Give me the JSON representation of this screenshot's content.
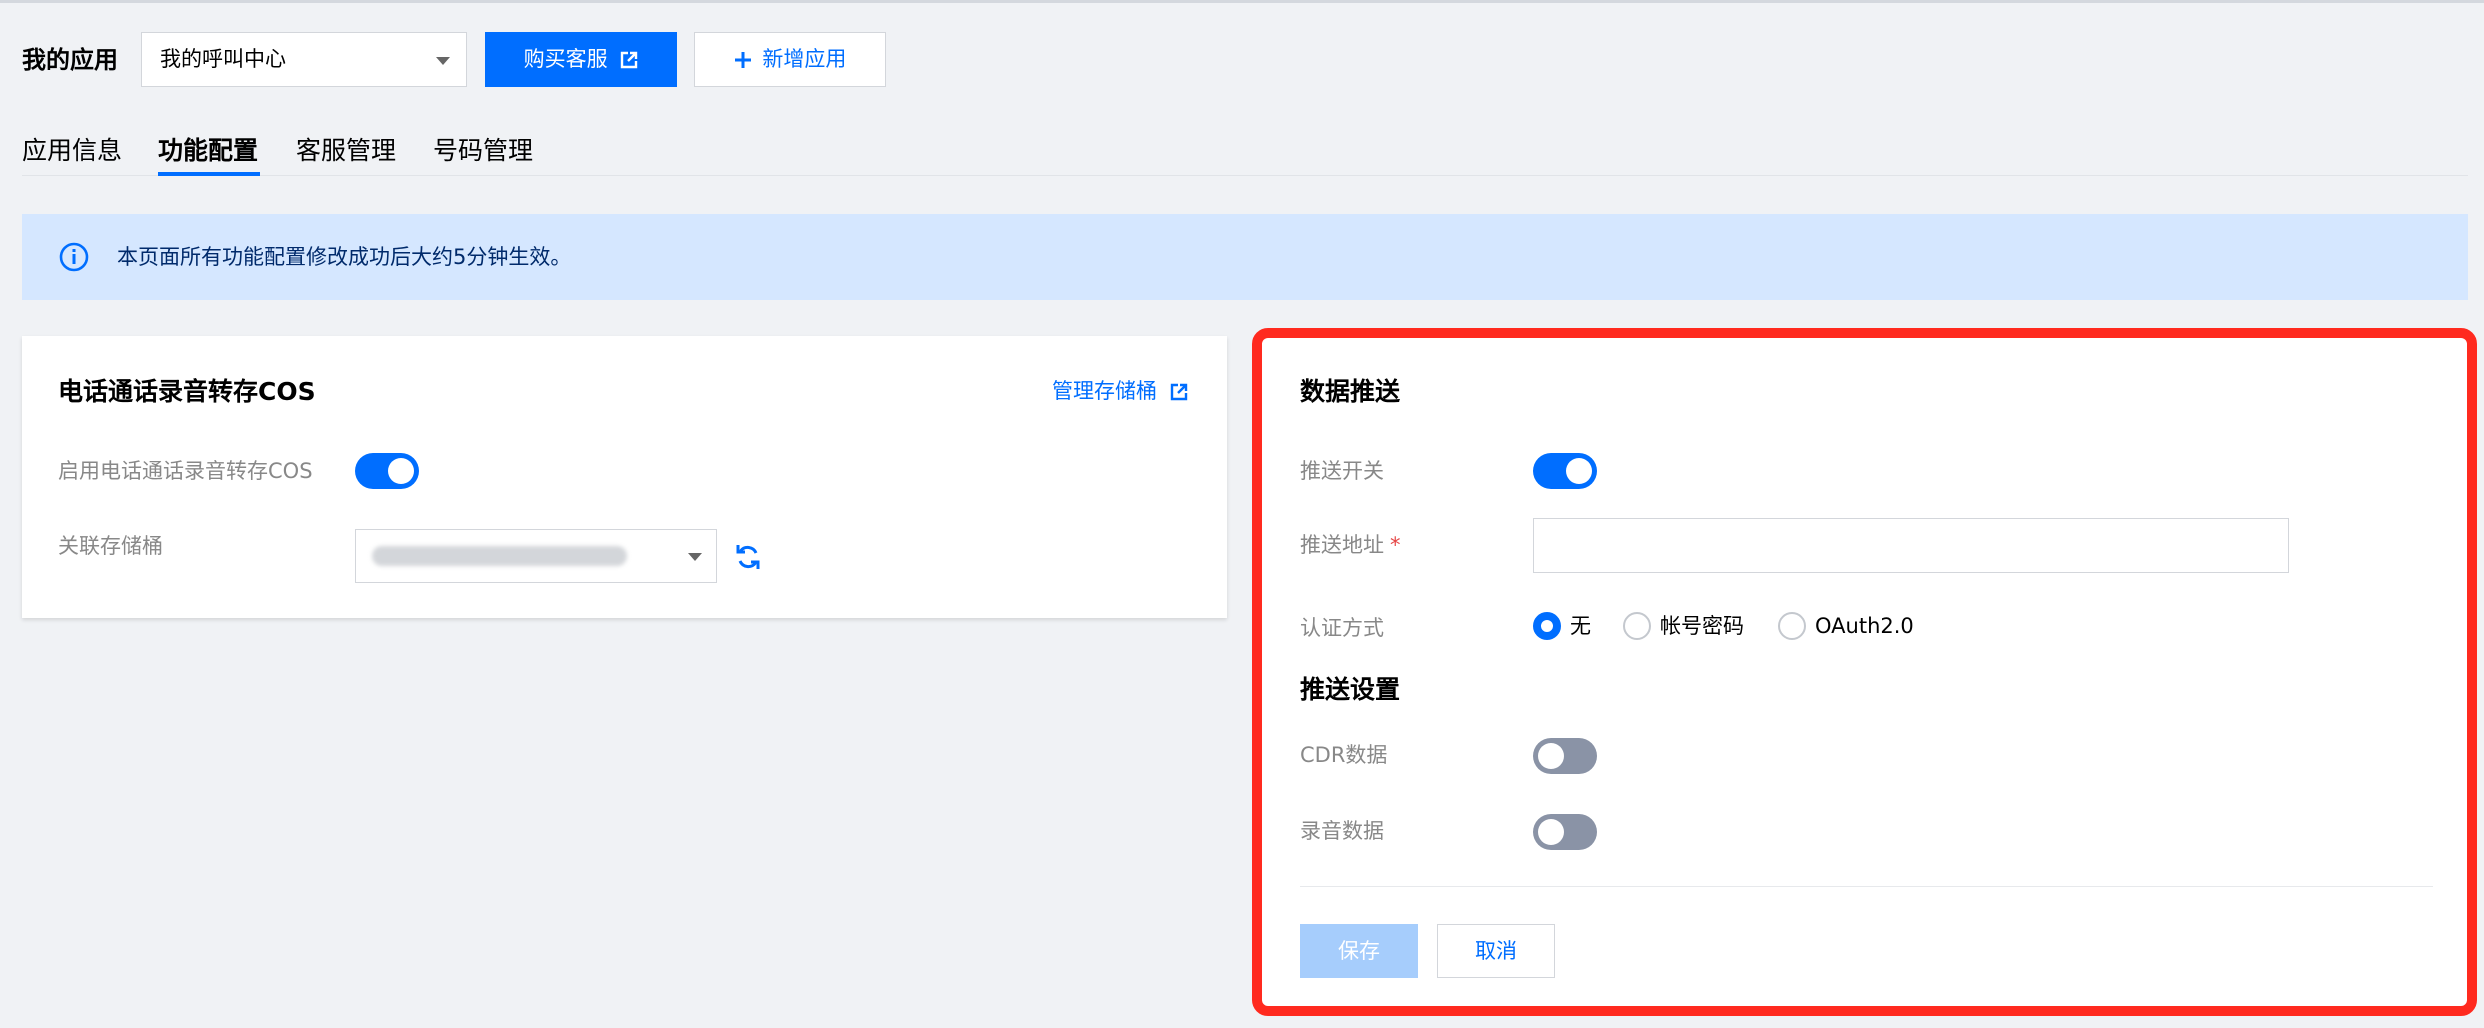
{
  "header": {
    "my_app_label": "我的应用",
    "app_select_value": "我的呼叫中心",
    "buy_button": "购买客服",
    "add_button": "新增应用"
  },
  "tabs": [
    {
      "label": "应用信息"
    },
    {
      "label": "功能配置"
    },
    {
      "label": "客服管理"
    },
    {
      "label": "号码管理"
    }
  ],
  "active_tab": "功能配置",
  "notice": {
    "text": "本页面所有功能配置修改成功后大约5分钟生效。"
  },
  "recording_card": {
    "title": "电话通话录音转存COS",
    "manage_link": "管理存储桶",
    "enable_label": "启用电话通话录音转存COS",
    "enable_on": true,
    "bucket_label": "关联存储桶"
  },
  "push_card": {
    "title": "数据推送",
    "switch_label": "推送开关",
    "switch_on": true,
    "address_label": "推送地址",
    "address_required_mark": "*",
    "address_value": "",
    "auth_label": "认证方式",
    "auth_options": [
      "无",
      "帐号密码",
      "OAuth2.0"
    ],
    "auth_selected": "无",
    "settings_title": "推送设置",
    "cdr_label": "CDR数据",
    "cdr_on": false,
    "record_label": "录音数据",
    "record_on": false,
    "save_button": "保存",
    "cancel_button": "取消"
  },
  "colors": {
    "primary": "#006eff",
    "highlight_border": "#ff2a1f",
    "notice_bg": "#d5e7ff",
    "toggle_off": "#8a93a6"
  }
}
